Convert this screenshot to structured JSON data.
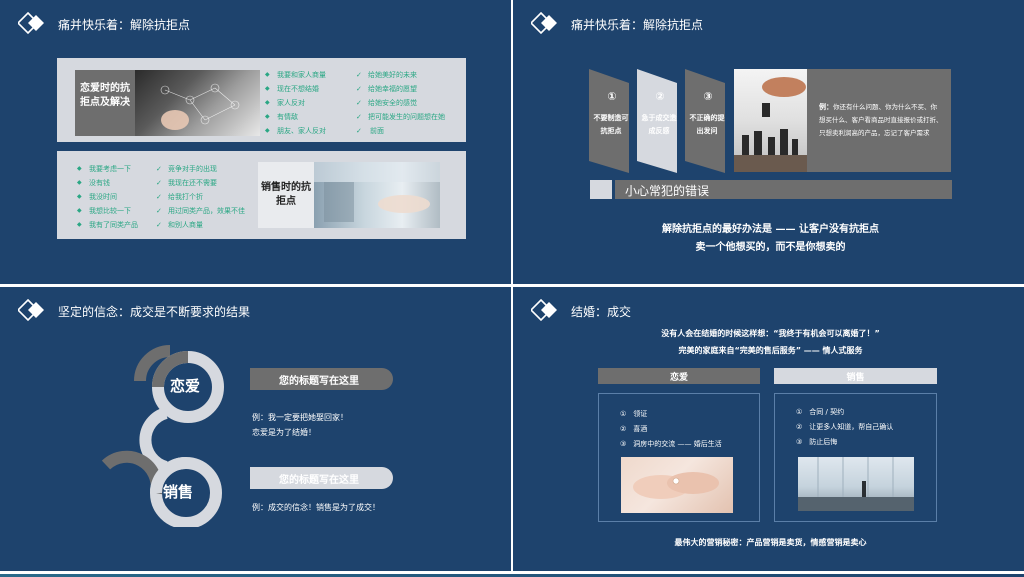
{
  "slides": [
    {
      "title": "痛并快乐着：解除抗拒点",
      "love_label": "恋爱时的抗拒点及解决",
      "love_list_a": [
        "我要和家人商量",
        "现在不想结婚",
        "家人反对",
        "有情敌",
        "朋友、家人反对"
      ],
      "love_list_b": [
        "给她美好的未来",
        "给她幸福的愿望",
        "给她安全的感觉",
        "把可能发生的问题想在她",
        "前面"
      ],
      "sales_list_a": [
        "我要考虑一下",
        "没有钱",
        "我没时间",
        "我想比较一下",
        "我有了同类产品"
      ],
      "sales_list_b": [
        "竞争对手的出现",
        "我现在还不需要",
        "给我打个折",
        "用过同类产品，效果不佳",
        "和别人商量"
      ],
      "sales_label": "销售时的抗拒点"
    },
    {
      "title": "痛并快乐着：解除抗拒点",
      "steps": [
        {
          "num": "①",
          "text": "不要制造可抗拒点"
        },
        {
          "num": "②",
          "text": "急于成交造成反感"
        },
        {
          "num": "③",
          "text": "不正确的提出发问"
        }
      ],
      "example_label": "例：",
      "example_text": "你还有什么问题、你为什么不买、你想买什么、客户看商品时直接报价或打折、只想卖利润高的产品，忘记了客户需求",
      "mistakes_label": "小心常犯的错误",
      "line1": "解除抗拒点的最好办法是 —— 让客户没有抗拒点",
      "line2": "卖一个他想买的，而不是你想卖的"
    },
    {
      "title": "坚定的信念：成交是不断要求的结果",
      "love_word": "恋爱",
      "sales_word": "销售",
      "banner1": "您的标题写在这里",
      "text1a": "例：我一定要把她娶回家！",
      "text1b": "恋爱是为了结婚！",
      "banner2": "您的标题写在这里",
      "text2": "例：成交的信念！销售是为了成交！"
    },
    {
      "title": "结婚：成交",
      "quote1": "没有人会在结婚的时候这样想：“我终于有机会可以离婚了！”",
      "quote2": "完美的家庭来自“完美的售后服务” —— 情人式服务",
      "col1_header": "恋爱",
      "col2_header": "销售",
      "col1_items": [
        "①　领证",
        "②　喜酒",
        "③　洞房中的交流 —— 婚后生活"
      ],
      "col2_items": [
        "①　合同 / 契约",
        "②　让更多人知道，帮自己确认",
        "③　防止后悔"
      ],
      "footer": "最伟大的营销秘密：产品营销是卖货，情感营销是卖心"
    }
  ],
  "colors": {
    "slide_bg": "#1e436d",
    "accent_green": "#2aa784",
    "gray_dark": "#6e6e6e",
    "panel_light": "#d6d9df"
  }
}
